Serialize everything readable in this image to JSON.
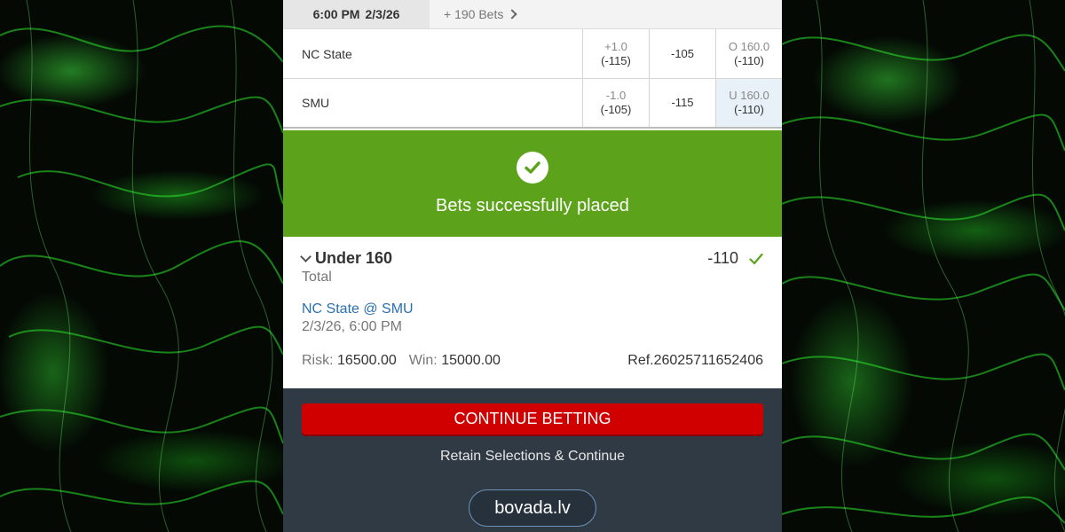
{
  "topbar": {
    "time": "6:00 PM",
    "date": "2/3/26",
    "more_bets": "+ 190 Bets"
  },
  "odds_rows": [
    {
      "team": "NC State",
      "spread_line": "+1.0",
      "spread_odds": "(-115)",
      "moneyline": "-105",
      "total_line": "O 160.0",
      "total_odds": "(-110)"
    },
    {
      "team": "SMU",
      "spread_line": "-1.0",
      "spread_odds": "(-105)",
      "moneyline": "-115",
      "total_line": "U 160.0",
      "total_odds": "(-110)"
    }
  ],
  "success": {
    "message": "Bets successfully placed"
  },
  "bet": {
    "pick": "Under 160",
    "odds": "-110",
    "type": "Total",
    "matchup": "NC State @ SMU",
    "datetime": "2/3/26, 6:00 PM",
    "risk_label": "Risk:",
    "risk_value": "16500.00",
    "win_label": "Win:",
    "win_value": "15000.00",
    "ref": "Ref.26025711652406"
  },
  "footer": {
    "continue_label": "CONTINUE BETTING",
    "retain_label": "Retain Selections & Continue",
    "brand": "bovada.lv"
  },
  "colors": {
    "success_green": "#5ca31b",
    "continue_red": "#d10000",
    "footer_bg": "#303a44",
    "link_blue": "#2a6fb2"
  }
}
